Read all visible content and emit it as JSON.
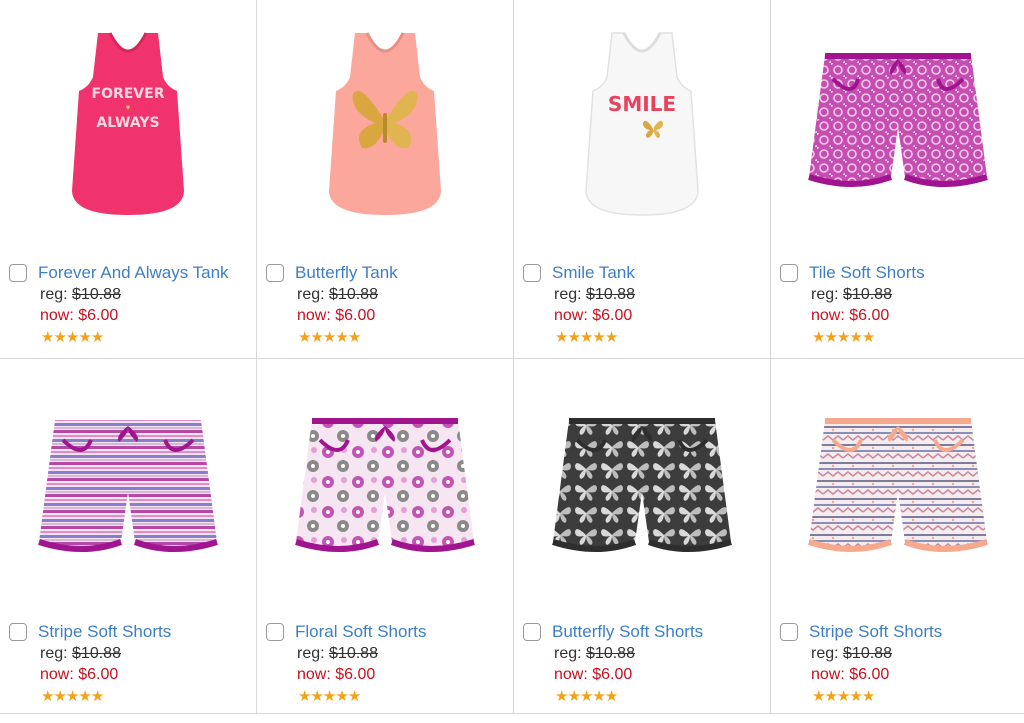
{
  "products": [
    {
      "title": "Forever And Always Tank",
      "reg_label": "reg:",
      "reg_price": "$10.88",
      "now_label": "now:",
      "now_price": "$6.00",
      "rating": 5,
      "print_text": [
        "FOREVER",
        "ALWAYS"
      ]
    },
    {
      "title": "Butterfly Tank",
      "reg_label": "reg:",
      "reg_price": "$10.88",
      "now_label": "now:",
      "now_price": "$6.00",
      "rating": 5
    },
    {
      "title": "Smile Tank",
      "reg_label": "reg:",
      "reg_price": "$10.88",
      "now_label": "now:",
      "now_price": "$6.00",
      "rating": 5,
      "print_text": [
        "SMILE"
      ]
    },
    {
      "title": "Tile Soft Shorts",
      "reg_label": "reg:",
      "reg_price": "$10.88",
      "now_label": "now:",
      "now_price": "$6.00",
      "rating": 5
    },
    {
      "title": "Stripe Soft Shorts",
      "reg_label": "reg:",
      "reg_price": "$10.88",
      "now_label": "now:",
      "now_price": "$6.00",
      "rating": 5
    },
    {
      "title": "Floral Soft Shorts",
      "reg_label": "reg:",
      "reg_price": "$10.88",
      "now_label": "now:",
      "now_price": "$6.00",
      "rating": 5
    },
    {
      "title": "Butterfly Soft Shorts",
      "reg_label": "reg:",
      "reg_price": "$10.88",
      "now_label": "now:",
      "now_price": "$6.00",
      "rating": 5
    },
    {
      "title": "Stripe Soft Shorts",
      "reg_label": "reg:",
      "reg_price": "$10.88",
      "now_label": "now:",
      "now_price": "$6.00",
      "rating": 5
    }
  ],
  "colors": {
    "title_link": "#3d7fc4",
    "sale_price": "#c8101e",
    "star": "#f5a21a",
    "divider": "#d8d8d8"
  }
}
